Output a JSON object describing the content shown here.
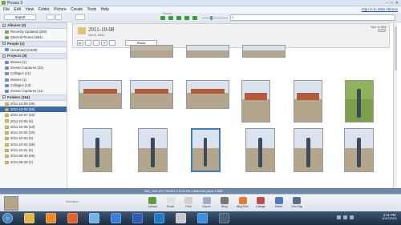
{
  "window": {
    "title": "Picasa 3",
    "controls": [
      "–",
      "□",
      "✕"
    ]
  },
  "menu": {
    "items": [
      "File",
      "Edit",
      "View",
      "Folder",
      "Picture",
      "Create",
      "Tools",
      "Help"
    ],
    "signin": "Sign in to Web Albums"
  },
  "toolbar": {
    "import_label": "Import",
    "photos_label": "Photos"
  },
  "sidebar": {
    "sections": [
      {
        "title": "Albums (2)",
        "items": [
          {
            "label": "Recently Updated (200)",
            "icon": "green"
          },
          {
            "label": "Starred Photos (994)",
            "icon": "green"
          }
        ]
      },
      {
        "title": "People (1)",
        "items": [
          {
            "label": "Unnamed (3,529)",
            "icon": "album"
          }
        ]
      },
      {
        "title": "Projects (8)",
        "items": [
          {
            "label": "Movies (1)",
            "icon": "album"
          },
          {
            "label": "Screen Captures (22)",
            "icon": "album"
          },
          {
            "label": "Collages (11)",
            "icon": "album"
          },
          {
            "label": "Movies (1)",
            "icon": "album"
          },
          {
            "label": "Collages (13)",
            "icon": "album"
          },
          {
            "label": "Screen Captures (11)",
            "icon": "album"
          }
        ]
      },
      {
        "title": "Folders (164)",
        "items": [
          {
            "label": "2011-10-09 (36)",
            "icon": "folder"
          },
          {
            "label": "2011-10-08 (88)",
            "icon": "folder",
            "selected": true
          },
          {
            "label": "2011-10-07 (20)",
            "icon": "folder"
          },
          {
            "label": "2011-10-06 (5)",
            "icon": "folder"
          },
          {
            "label": "2011-10-05 (10)",
            "icon": "folder"
          },
          {
            "label": "2011-10-04 (33)",
            "icon": "folder"
          },
          {
            "label": "2011-10-03 (6)",
            "icon": "folder"
          },
          {
            "label": "2011-10-02 (56)",
            "icon": "folder"
          },
          {
            "label": "2011-10-01 (5)",
            "icon": "folder"
          },
          {
            "label": "2011-09-30 (46)",
            "icon": "folder"
          },
          {
            "label": "2011-09-28 (2)",
            "icon": "folder"
          }
        ]
      }
    ]
  },
  "folder_header": {
    "title": "2011-10-08",
    "date": "Oct 8, 2011",
    "share_label": "Share",
    "sync_label": "Sync to Web"
  },
  "status": {
    "text": "IMG_7461.JPG    7/5/2011 2:29:05 PM    3,888x2592 pixels    3.3MB"
  },
  "tray": {
    "selection_label": "Selection",
    "buttons": [
      {
        "label": "Upload",
        "color": "#5aa03a"
      },
      {
        "label": "Email",
        "color": "#e2e2e2"
      },
      {
        "label": "Print",
        "color": "#cfcfcf"
      },
      {
        "label": "Export",
        "color": "#9fb0c6"
      },
      {
        "label": "Shop",
        "color": "#777777"
      },
      {
        "label": "BlogThis!",
        "color": "#e87a2b"
      },
      {
        "label": "Collage",
        "color": "#c14a4a"
      },
      {
        "label": "Movie",
        "color": "#4e7cc4"
      },
      {
        "label": "Geo-Tag",
        "color": "#5a6d8c"
      }
    ]
  },
  "taskbar": {
    "time": "2:21 PM",
    "date": "10/12/2011",
    "apps": [
      {
        "name": "explorer",
        "color": "#e2b64b"
      },
      {
        "name": "media",
        "color": "#f08a24"
      },
      {
        "name": "firefox",
        "color": "#e5632b"
      },
      {
        "name": "network",
        "color": "#6fb5e5"
      },
      {
        "name": "mail",
        "color": "#3b7dd8"
      },
      {
        "name": "word",
        "color": "#2b5fb5"
      },
      {
        "name": "outlook",
        "color": "#1f7ccc"
      },
      {
        "name": "picasa",
        "color": "#c8c8c8"
      },
      {
        "name": "help",
        "color": "#3c8ee0"
      },
      {
        "name": "settings",
        "color": "#4a5e78"
      }
    ]
  }
}
